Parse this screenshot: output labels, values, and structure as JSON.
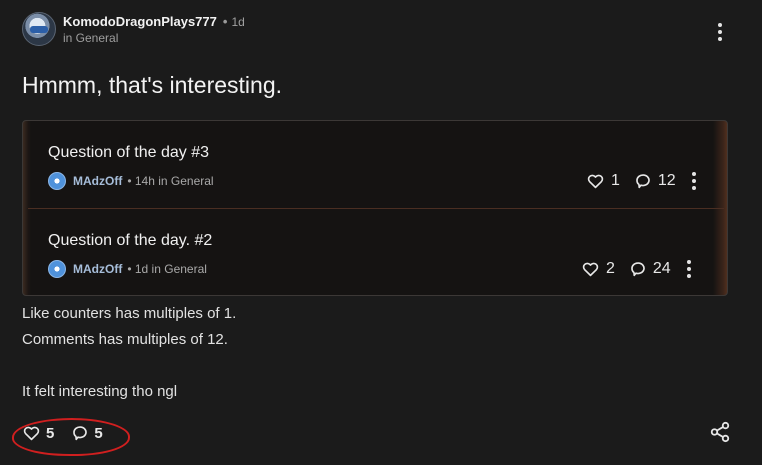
{
  "post": {
    "author": "KomodoDragonPlays777",
    "time": "1d",
    "category": "in General",
    "title": "Hmmm, that's interesting.",
    "body": [
      "Like counters has multiples of 1.",
      "Comments has multiples of 12.",
      "",
      "It felt interesting tho ngl"
    ],
    "likes": "5",
    "comments": "5"
  },
  "embeds": [
    {
      "title": "Question of the day #3",
      "author": "MAdzOff",
      "time_category": "14h in General",
      "likes": "1",
      "comments": "12"
    },
    {
      "title": "Question of the day. #2",
      "author": "MAdzOff",
      "time_category": "1d in General",
      "likes": "2",
      "comments": "24"
    }
  ],
  "colors": {
    "background": "#1b1b1b",
    "highlight_annotation": "#d01f1f"
  },
  "icons": [
    "more-options-icon",
    "heart-icon",
    "comment-icon",
    "share-icon"
  ]
}
